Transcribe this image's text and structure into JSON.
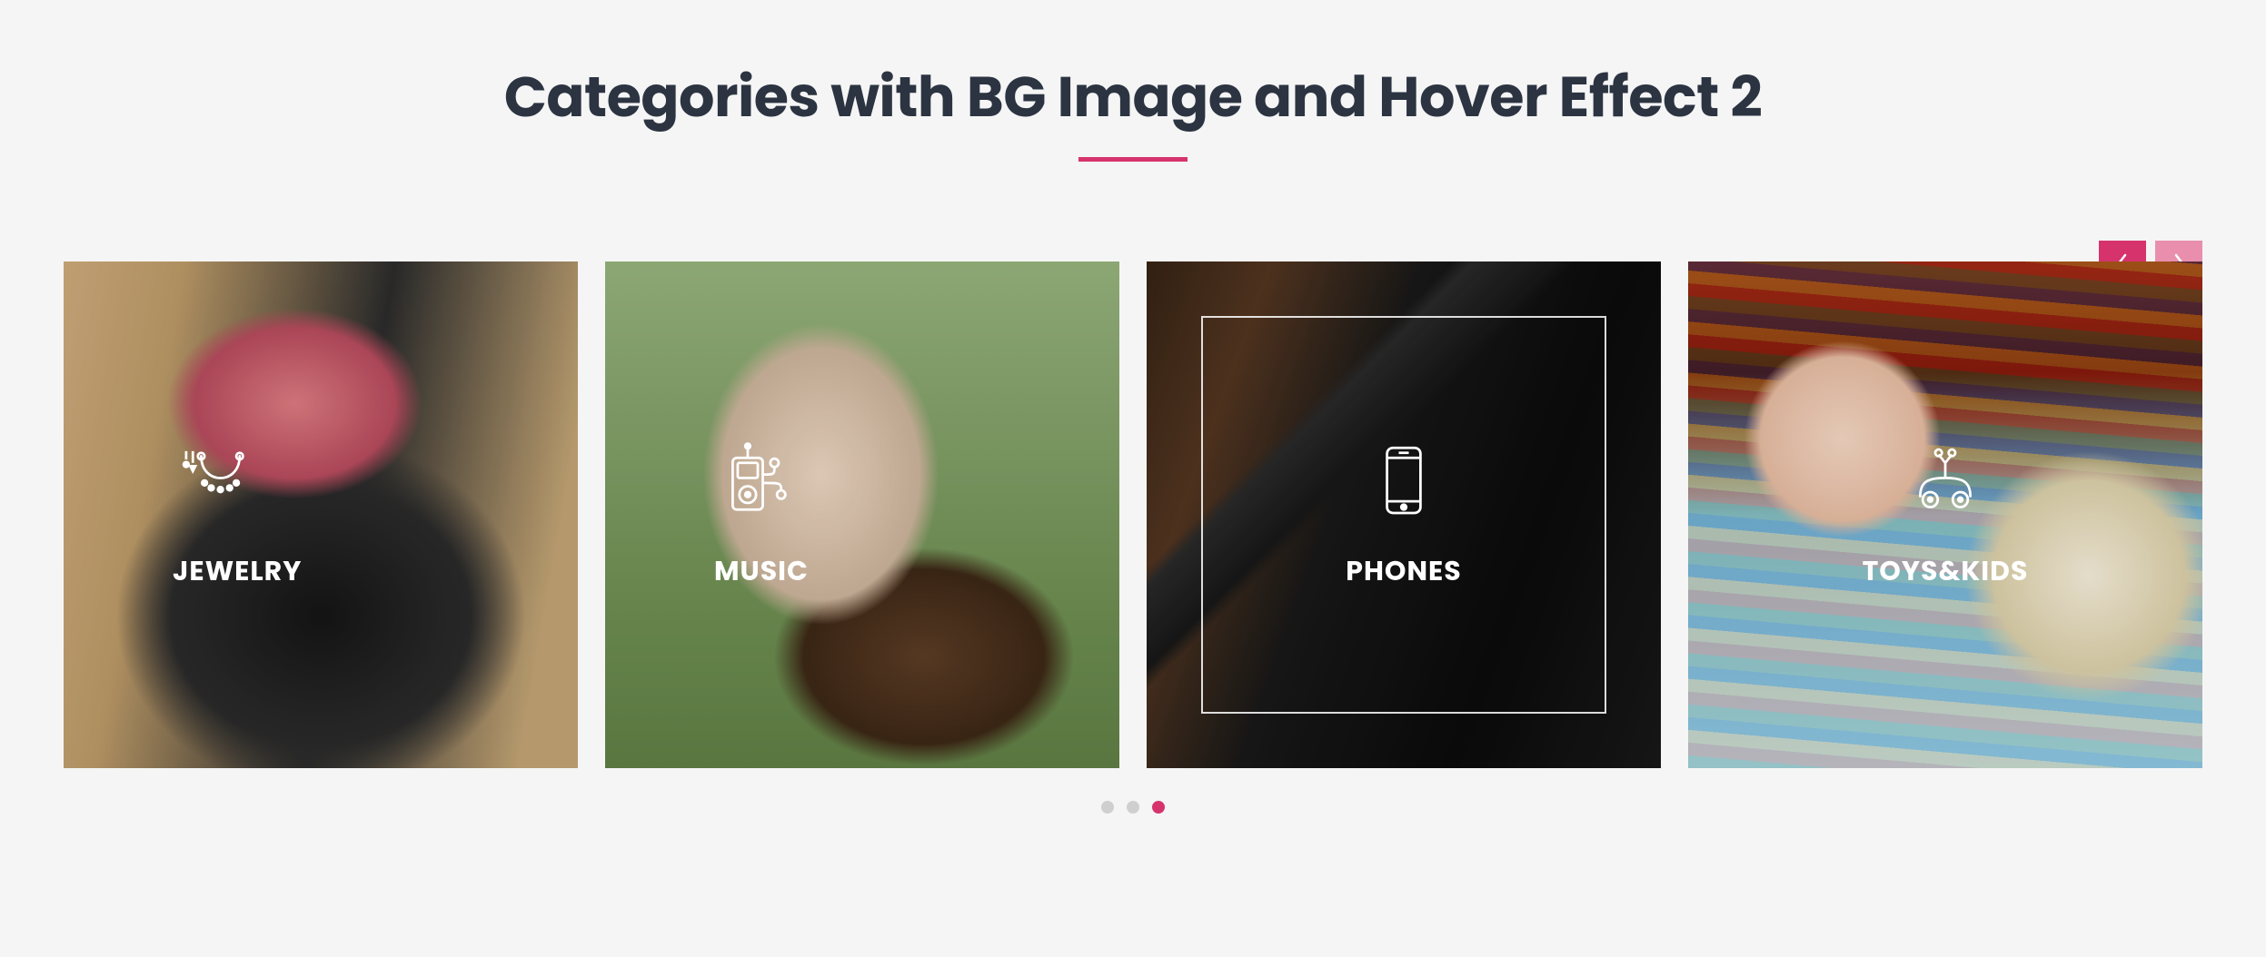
{
  "title": "Categories with BG Image and Hover Effect 2",
  "nav": {
    "prev": "prev",
    "next": "next"
  },
  "categories": [
    {
      "label": "JEWELRY",
      "icon": "necklace-icon",
      "active": false
    },
    {
      "label": "MUSIC",
      "icon": "music-player-icon",
      "active": false
    },
    {
      "label": "PHONES",
      "icon": "smartphone-icon",
      "active": true
    },
    {
      "label": "TOYS&KIDS",
      "icon": "toy-car-icon",
      "active": false
    }
  ],
  "dots": {
    "count": 3,
    "activeIndex": 2
  },
  "colors": {
    "accent": "#d6336c",
    "heading": "#2c3442",
    "navInactive": "#e98fad",
    "dotInactive": "#cfcfcf"
  }
}
